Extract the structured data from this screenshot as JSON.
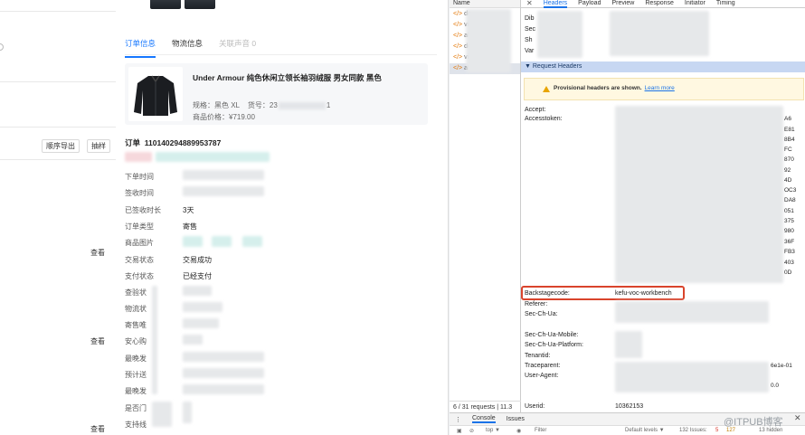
{
  "background_app": {
    "export_button": "顺序导出",
    "sample_button": "抽样",
    "view_links": [
      "查看",
      "查看",
      "查看"
    ]
  },
  "drawer": {
    "tabs": [
      {
        "label": "订单信息",
        "state": "active"
      },
      {
        "label": "物流信息",
        "state": "normal"
      },
      {
        "label": "关联声音 0",
        "state": "disabled"
      }
    ],
    "product": {
      "title": "Under Armour 纯色休闲立领长袖羽绒服 男女同款 黑色",
      "spec_label": "规格：",
      "spec_value": "黑色 XL",
      "sku_label": "货号：",
      "sku_prefix": "23",
      "sku_suffix": "1",
      "price_label": "商品价格：",
      "price": "¥719.00"
    },
    "order_label": "订单",
    "order_number": "110140294889953787",
    "fields": [
      {
        "label": "下单时间",
        "value": ""
      },
      {
        "label": "签收时间",
        "value": ""
      },
      {
        "label": "已签收时长",
        "value": "3天"
      },
      {
        "label": "订单类型",
        "value": "寄售"
      },
      {
        "label": "商品图片",
        "value": ""
      },
      {
        "label": "交易状态",
        "value": "交易成功"
      },
      {
        "label": "支付状态",
        "value": "已经支付"
      },
      {
        "label": "查验状",
        "value": ""
      },
      {
        "label": "物流状",
        "value": ""
      },
      {
        "label": "寄售唯",
        "value": ""
      },
      {
        "label": "安心购",
        "value": ""
      },
      {
        "label": "最晚发",
        "value": ""
      },
      {
        "label": "预计送",
        "value": ""
      },
      {
        "label": "最晚发",
        "value": ""
      },
      {
        "label": "是否门",
        "value": ""
      },
      {
        "label": "支持线",
        "value": ""
      }
    ]
  },
  "devtools": {
    "list_header": "Name",
    "requests": [
      {
        "prefix": "de",
        "selected": false
      },
      {
        "prefix": "vi",
        "selected": false
      },
      {
        "prefix": "all",
        "selected": false
      },
      {
        "prefix": "de",
        "selected": false
      },
      {
        "prefix": "vi",
        "selected": false
      },
      {
        "prefix": "all",
        "selected": true
      }
    ],
    "requests_summary": "6 / 31 requests",
    "requests_size": "11.3",
    "close_glyph": "✕",
    "detail_tabs": [
      {
        "label": "Headers",
        "state": "active"
      },
      {
        "label": "Payload",
        "state": "normal"
      },
      {
        "label": "Preview",
        "state": "normal"
      },
      {
        "label": "Response",
        "state": "normal"
      },
      {
        "label": "Initiator",
        "state": "normal"
      },
      {
        "label": "Timing",
        "state": "normal"
      }
    ],
    "response_header_fragments": [
      "Dib",
      "Sec",
      "Sh",
      "Var"
    ],
    "request_headers_title": "▼ Request Headers",
    "warning_text": "Provisional headers are shown.",
    "warning_link": "Learn more",
    "accept_label": "Accept:",
    "accesstoken_label": "Accesstoken:",
    "token_fragments": [
      "A6",
      "E81",
      "8B4",
      "FC",
      "870",
      "92",
      "4D",
      "OC3",
      "DA8",
      "051",
      "375",
      "980",
      "36F",
      "FB3",
      "403",
      "0D"
    ],
    "backstage_label": "Backstagecode:",
    "backstage_value": "kefu-voc-workbench",
    "referer_label": "Referer:",
    "sec_ua_label": "Sec-Ch-Ua:",
    "sec_mobile_label": "Sec-Ch-Ua-Mobile:",
    "sec_platform_label": "Sec-Ch-Ua-Platform:",
    "tenantid_label": "Tenantid:",
    "traceparent_label": "Traceparent:",
    "traceparent_frag": "6e1e-01",
    "useragent_label": "User-Agent:",
    "useragent_frag": "0.0",
    "userid_label": "Userid:",
    "userid_value": "10362153",
    "console_tabs": [
      {
        "label": "Console",
        "state": "active"
      },
      {
        "label": "Issues",
        "state": "normal"
      }
    ],
    "menu_glyph": "⋮",
    "filter_bar": {
      "top_label": "top ▼",
      "filter_placeholder": "Filter",
      "levels": "Default levels ▼",
      "issues": "132 Issues:",
      "errors": "5",
      "warnings": "127",
      "hidden": "13 hidden"
    }
  },
  "watermark": "@ITPUB博客",
  "watermark_close": "✕"
}
